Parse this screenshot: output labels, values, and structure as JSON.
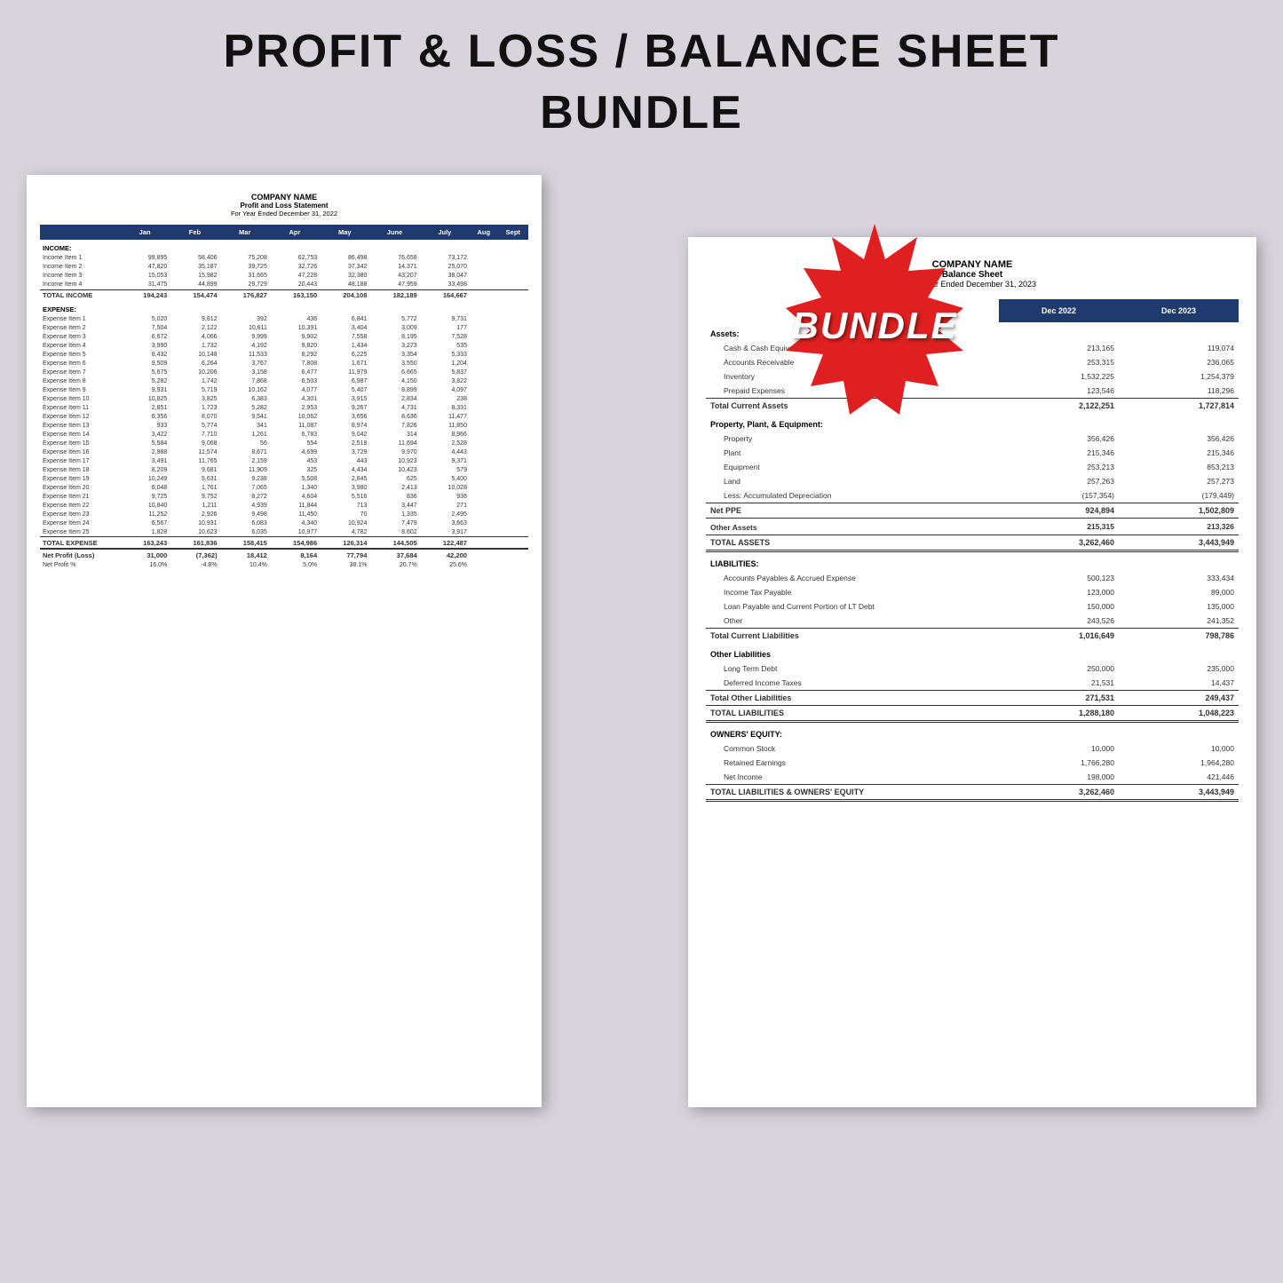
{
  "page": {
    "title_line1": "PROFIT & LOSS / BALANCE SHEET",
    "title_line2": "BUNDLE",
    "background_color": "#d8d4dc"
  },
  "bundle_badge": {
    "label": "BUNDLE",
    "color": "#e02020"
  },
  "pl_sheet": {
    "company_name": "COMPANY NAME",
    "title": "Profit and Loss Statement",
    "subtitle": "For Year Ended December 31, 2022",
    "columns": [
      "Jan",
      "Feb",
      "Mar",
      "Apr",
      "May",
      "June",
      "July",
      "Aug",
      "Sept"
    ],
    "income_section_label": "INCOME:",
    "income_items": [
      {
        "label": "Income Item 1",
        "values": [
          "99,895",
          "58,406",
          "75,208",
          "62,753",
          "86,498",
          "76,658",
          "73,172"
        ]
      },
      {
        "label": "Income Item 2",
        "values": [
          "47,820",
          "35,187",
          "39,725",
          "32,726",
          "37,342",
          "14,371",
          "25,070"
        ]
      },
      {
        "label": "Income Item 3",
        "values": [
          "15,053",
          "15,982",
          "31,665",
          "47,228",
          "32,380",
          "43,207",
          "38,047"
        ]
      },
      {
        "label": "Income Item 4",
        "values": [
          "31,475",
          "44,899",
          "29,729",
          "20,443",
          "48,188",
          "47,959",
          "33,498"
        ]
      }
    ],
    "total_income_label": "TOTAL INCOME",
    "total_income_values": [
      "194,243",
      "154,474",
      "176,827",
      "163,150",
      "204,108",
      "182,189",
      "164,667"
    ],
    "expense_section_label": "EXPENSE:",
    "expense_items": [
      {
        "label": "Expense Item 1",
        "values": [
          "5,020",
          "9,812",
          "392",
          "436",
          "6,841",
          "5,772",
          "9,731"
        ]
      },
      {
        "label": "Expense Item 2",
        "values": [
          "7,504",
          "2,122",
          "10,811",
          "10,391",
          "3,404",
          "3,009",
          "177"
        ]
      },
      {
        "label": "Expense Item 3",
        "values": [
          "6,672",
          "4,066",
          "9,999",
          "9,902",
          "7,558",
          "8,195",
          "7,528"
        ]
      },
      {
        "label": "Expense Item 4",
        "values": [
          "3,990",
          "1,732",
          "4,192",
          "9,820",
          "1,434",
          "3,273",
          "535"
        ]
      },
      {
        "label": "Expense Item 5",
        "values": [
          "8,432",
          "10,148",
          "11,533",
          "8,292",
          "6,225",
          "3,354",
          "5,333"
        ]
      },
      {
        "label": "Expense Item 6",
        "values": [
          "9,509",
          "6,264",
          "3,767",
          "7,808",
          "1,671",
          "3,550",
          "1,204"
        ]
      },
      {
        "label": "Expense Item 7",
        "values": [
          "5,675",
          "10,206",
          "3,158",
          "6,477",
          "11,979",
          "6,665",
          "5,837"
        ]
      },
      {
        "label": "Expense Item 8",
        "values": [
          "5,282",
          "1,742",
          "7,868",
          "6,503",
          "6,987",
          "4,150",
          "3,822"
        ]
      },
      {
        "label": "Expense Item 9",
        "values": [
          "9,931",
          "5,719",
          "10,162",
          "4,077",
          "5,407",
          "8,899",
          "4,097"
        ]
      },
      {
        "label": "Expense Item 10",
        "values": [
          "10,825",
          "3,825",
          "6,383",
          "4,301",
          "3,915",
          "2,834",
          "238"
        ]
      },
      {
        "label": "Expense Item 11",
        "values": [
          "2,851",
          "1,723",
          "5,282",
          "2,953",
          "9,267",
          "4,731",
          "8,331"
        ]
      },
      {
        "label": "Expense Item 12",
        "values": [
          "6,356",
          "8,070",
          "9,541",
          "10,062",
          "3,656",
          "8,636",
          "11,477"
        ]
      },
      {
        "label": "Expense Item 13",
        "values": [
          "933",
          "5,774",
          "341",
          "11,087",
          "8,974",
          "7,826",
          "11,850"
        ]
      },
      {
        "label": "Expense Item 14",
        "values": [
          "3,422",
          "7,710",
          "1,261",
          "6,783",
          "9,042",
          "314",
          "8,966"
        ]
      },
      {
        "label": "Expense Item 15",
        "values": [
          "5,584",
          "9,068",
          "56",
          "554",
          "2,518",
          "11,694",
          "2,528"
        ]
      },
      {
        "label": "Expense Item 16",
        "values": [
          "2,988",
          "11,574",
          "8,671",
          "4,699",
          "3,729",
          "9,970",
          "4,443"
        ]
      },
      {
        "label": "Expense Item 17",
        "values": [
          "3,491",
          "11,765",
          "2,159",
          "453",
          "443",
          "10,923",
          "9,371"
        ]
      },
      {
        "label": "Expense Item 18",
        "values": [
          "8,209",
          "9,681",
          "11,909",
          "325",
          "4,434",
          "10,423",
          "579"
        ]
      },
      {
        "label": "Expense Item 19",
        "values": [
          "10,249",
          "5,631",
          "9,238",
          "5,508",
          "2,845",
          "625",
          "5,400"
        ]
      },
      {
        "label": "Expense Item 20",
        "values": [
          "6,048",
          "1,761",
          "7,065",
          "1,340",
          "3,980",
          "2,413",
          "10,028"
        ]
      },
      {
        "label": "Expense Item 21",
        "values": [
          "9,725",
          "9,752",
          "8,272",
          "4,604",
          "5,516",
          "836",
          "936"
        ]
      },
      {
        "label": "Expense Item 22",
        "values": [
          "10,840",
          "1,211",
          "4,939",
          "11,844",
          "713",
          "3,447",
          "271"
        ]
      },
      {
        "label": "Expense Item 23",
        "values": [
          "11,252",
          "2,926",
          "9,498",
          "11,450",
          "70",
          "1,335",
          "2,495"
        ]
      },
      {
        "label": "Expense Item 24",
        "values": [
          "6,567",
          "10,931",
          "6,083",
          "4,340",
          "10,924",
          "7,479",
          "3,663"
        ]
      },
      {
        "label": "Expense Item 25",
        "values": [
          "1,828",
          "10,623",
          "6,035",
          "10,977",
          "4,782",
          "8,602",
          "3,917"
        ]
      }
    ],
    "total_expense_label": "TOTAL EXPENSE",
    "total_expense_values": [
      "163,243",
      "161,836",
      "158,415",
      "154,986",
      "126,314",
      "144,505",
      "122,487"
    ],
    "net_profit_label": "Net Profit (Loss)",
    "net_profit_values": [
      "31,000",
      "(7,362)",
      "18,412",
      "8,164",
      "77,794",
      "37,684",
      "42,200"
    ],
    "net_profit_pct_label": "Net Profit %",
    "net_profit_pct_values": [
      "16.0%",
      "-4.8%",
      "10.4%",
      "5.0%",
      "38.1%",
      "20.7%",
      "25.6%"
    ]
  },
  "bs_sheet": {
    "company_name": "COMPANY NAME",
    "title": "Balance Sheet",
    "subtitle": "For Year Ended December 31, 2023",
    "col1_label": "Dec 2022",
    "col2_label": "Dec 2023",
    "assets_label": "Assets:",
    "asset_items": [
      {
        "label": "Cash & Cash Equivalents",
        "col1": "213,165",
        "col2": "119,074"
      },
      {
        "label": "Accounts Receivable",
        "col1": "253,315",
        "col2": "236,065"
      },
      {
        "label": "Inventory",
        "col1": "1,532,225",
        "col2": "1,254,379"
      },
      {
        "label": "Prepaid Expenses",
        "col1": "123,546",
        "col2": "118,296"
      }
    ],
    "total_current_assets_label": "Total Current Assets",
    "total_current_assets_col1": "2,122,251",
    "total_current_assets_col2": "1,727,814",
    "ppe_label": "Property, Plant, & Equipment:",
    "ppe_items": [
      {
        "label": "Property",
        "col1": "356,426",
        "col2": "356,426"
      },
      {
        "label": "Plant",
        "col1": "215,346",
        "col2": "215,346"
      },
      {
        "label": "Equipment",
        "col1": "253,213",
        "col2": "853,213"
      },
      {
        "label": "Land",
        "col1": "257,263",
        "col2": "257,273"
      },
      {
        "label": "Less:  Accumulated Depreciation",
        "col1": "(157,354)",
        "col2": "(179,449)"
      }
    ],
    "net_ppe_label": "Net PPE",
    "net_ppe_col1": "924,894",
    "net_ppe_col2": "1,502,809",
    "other_assets_label": "Other Assets",
    "other_assets_col1": "215,315",
    "other_assets_col2": "213,326",
    "total_assets_label": "TOTAL ASSETS",
    "total_assets_col1": "3,262,460",
    "total_assets_col2": "3,443,949",
    "liabilities_label": "LIABILITIES:",
    "liability_items": [
      {
        "label": "Accounts Payables & Accrued Expense",
        "col1": "500,123",
        "col2": "333,434"
      },
      {
        "label": "Income Tax Payable",
        "col1": "123,000",
        "col2": "89,000"
      },
      {
        "label": "Loan Payable and Current Portion of LT Debt",
        "col1": "150,000",
        "col2": "135,000"
      },
      {
        "label": "Other",
        "col1": "243,526",
        "col2": "241,352"
      }
    ],
    "total_current_liabilities_label": "Total Current Liabilities",
    "total_current_liabilities_col1": "1,016,649",
    "total_current_liabilities_col2": "798,786",
    "other_liabilities_label": "Other Liabilities",
    "other_liability_items": [
      {
        "label": "Long Term Debt",
        "col1": "250,000",
        "col2": "235,000"
      },
      {
        "label": "Deferred Income Taxes",
        "col1": "21,531",
        "col2": "14,437"
      }
    ],
    "total_other_liabilities_label": "Total Other Liabilities",
    "total_other_liabilities_col1": "271,531",
    "total_other_liabilities_col2": "249,437",
    "total_liabilities_label": "TOTAL LIABILITIES",
    "total_liabilities_col1": "1,288,180",
    "total_liabilities_col2": "1,048,223",
    "equity_label": "OWNERS' EQUITY:",
    "equity_items": [
      {
        "label": "Common Stock",
        "col1": "10,000",
        "col2": "10,000"
      },
      {
        "label": "Retained Earnings",
        "col1": "1,766,280",
        "col2": "1,964,280"
      },
      {
        "label": "Net Income",
        "col1": "198,000",
        "col2": "421,446"
      }
    ],
    "total_equity_label": "TOTAL LIABILITIES & OWNERS' EQUITY",
    "total_equity_col1": "3,262,460",
    "total_equity_col2": "3,443,949"
  }
}
